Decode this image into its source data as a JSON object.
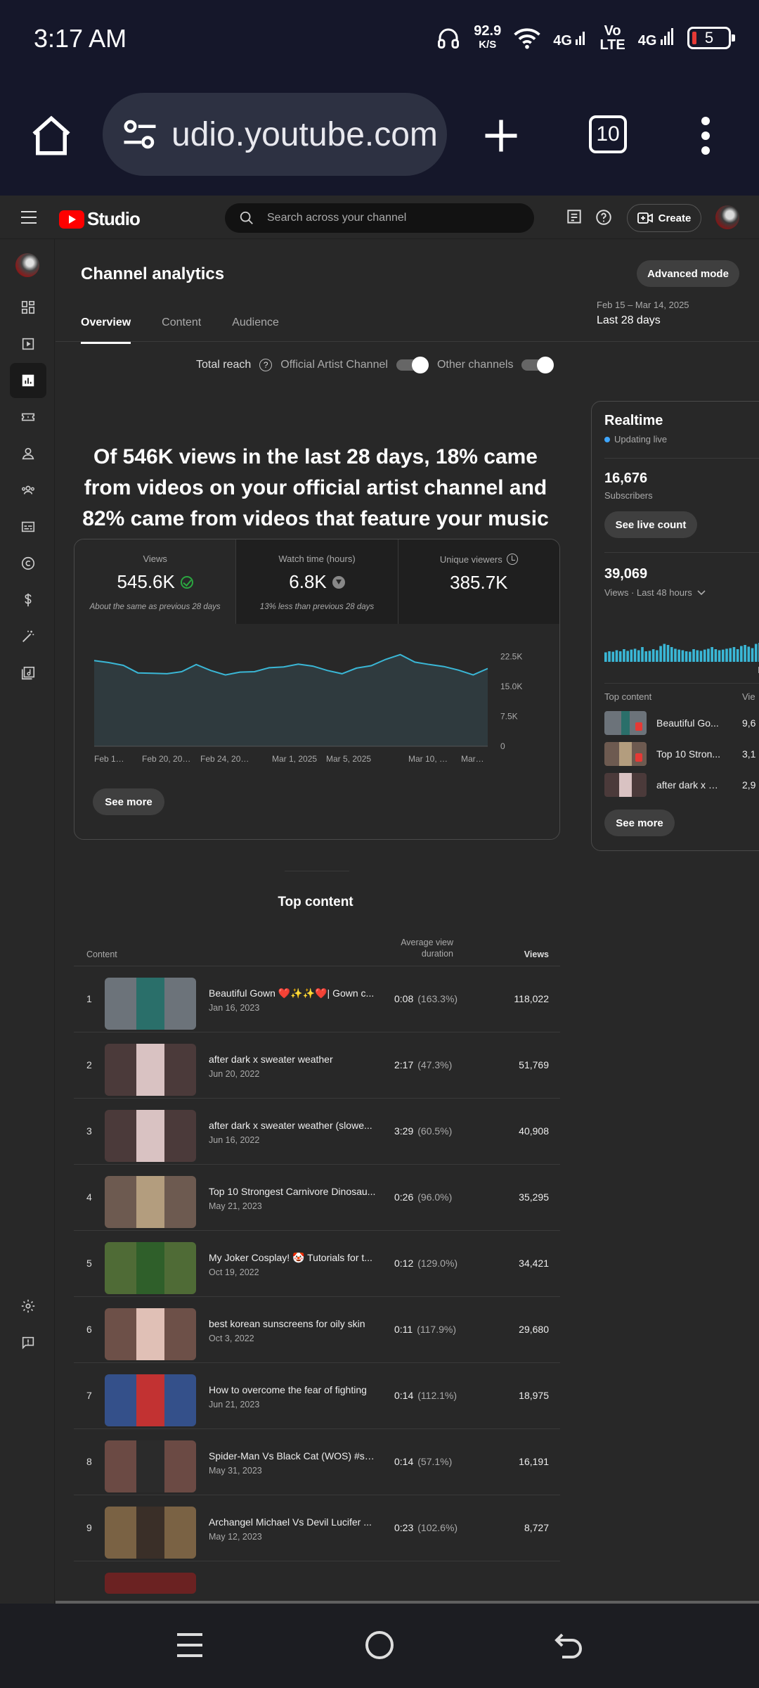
{
  "status_bar": {
    "time": "3:17 AM",
    "net_speed": "92.9",
    "net_speed_unit": "K/S",
    "signal1": "4G",
    "volte_1": "Vo",
    "volte_2": "LTE",
    "signal2": "4G",
    "battery": "5"
  },
  "browser": {
    "url": "udio.youtube.com",
    "tab_count": "10"
  },
  "studio": {
    "logo_text": "Studio",
    "search_placeholder": "Search across your channel",
    "create_label": "Create"
  },
  "page": {
    "title": "Channel analytics",
    "advanced_mode": "Advanced mode",
    "tabs": [
      "Overview",
      "Content",
      "Audience"
    ],
    "date_range": "Feb 15 – Mar 14, 2025",
    "period": "Last 28 days",
    "total_reach": "Total reach",
    "toggle_official": "Official Artist Channel",
    "toggle_other": "Other channels",
    "headline": "Of 546K views in the last 28 days, 18% came from videos on your official artist channel and 82% came from videos that feature your music on other channels"
  },
  "metrics": [
    {
      "label": "Views",
      "value": "545.6K",
      "note": "About the same as previous 28 days"
    },
    {
      "label": "Watch time (hours)",
      "value": "6.8K",
      "note": "13% less than previous 28 days"
    },
    {
      "label": "Unique viewers",
      "value": "385.7K",
      "note": ""
    }
  ],
  "chart_data": {
    "type": "area",
    "x_tick_labels": [
      "Feb 1…",
      "Feb 20, 20…",
      "Feb 24, 20…",
      "Mar 1, 2025",
      "Mar 5, 2025",
      "Mar 10, …",
      "Mar…"
    ],
    "y_tick_labels": [
      "22.5K",
      "15.0K",
      "7.5K",
      "0"
    ],
    "ylim": [
      0,
      30000
    ],
    "values": [
      21500,
      21000,
      20300,
      18400,
      18300,
      18200,
      18700,
      20500,
      19000,
      17900,
      18600,
      18700,
      19700,
      19900,
      20600,
      20100,
      19000,
      18200,
      19600,
      20200,
      21800,
      23000,
      21100,
      20500,
      20000,
      19100,
      17900,
      19500
    ],
    "color": "#3ab7d6",
    "grid": false
  },
  "see_more": "See more",
  "top_content": {
    "title": "Top content",
    "col_content": "Content",
    "col_avd": "Average view duration",
    "col_views": "Views",
    "rows": [
      {
        "rank": "1",
        "title": "Beautiful Gown ❤️✨✨❤️| Gown c...",
        "date": "Jan 16, 2023",
        "duration": "0:08",
        "pct": "(163.3%)",
        "views": "118,022"
      },
      {
        "rank": "2",
        "title": "after dark x sweater weather",
        "date": "Jun 20, 2022",
        "duration": "2:17",
        "pct": "(47.3%)",
        "views": "51,769"
      },
      {
        "rank": "3",
        "title": "after dark x sweater weather (slowe...",
        "date": "Jun 16, 2022",
        "duration": "3:29",
        "pct": "(60.5%)",
        "views": "40,908"
      },
      {
        "rank": "4",
        "title": "Top 10 Strongest Carnivore Dinosau...",
        "date": "May 21, 2023",
        "duration": "0:26",
        "pct": "(96.0%)",
        "views": "35,295"
      },
      {
        "rank": "5",
        "title": "My Joker Cosplay! 🤡 Tutorials for t...",
        "date": "Oct 19, 2022",
        "duration": "0:12",
        "pct": "(129.0%)",
        "views": "34,421"
      },
      {
        "rank": "6",
        "title": "best korean sunscreens for oily skin",
        "date": "Oct 3, 2022",
        "duration": "0:11",
        "pct": "(117.9%)",
        "views": "29,680"
      },
      {
        "rank": "7",
        "title": "How to overcome the fear of fighting",
        "date": "Jun 21, 2023",
        "duration": "0:14",
        "pct": "(112.1%)",
        "views": "18,975"
      },
      {
        "rank": "8",
        "title": "Spider-Man Vs Black Cat (WOS) #sh...",
        "date": "May 31, 2023",
        "duration": "0:14",
        "pct": "(57.1%)",
        "views": "16,191"
      },
      {
        "rank": "9",
        "title": "Archangel Michael Vs Devil Lucifer ...",
        "date": "May 12, 2023",
        "duration": "0:23",
        "pct": "(102.6%)",
        "views": "8,727"
      }
    ]
  },
  "realtime": {
    "title": "Realtime",
    "live": "Updating live",
    "subscribers": "16,676",
    "subscribers_label": "Subscribers",
    "see_live": "See live count",
    "views": "39,069",
    "views_label": "Views · Last 48 hours",
    "bar_axis_label": "N",
    "top_content_label": "Top content",
    "top_content_views_label": "Vie",
    "bars": [
      0.45,
      0.5,
      0.48,
      0.55,
      0.5,
      0.6,
      0.52,
      0.58,
      0.62,
      0.55,
      0.7,
      0.5,
      0.52,
      0.6,
      0.55,
      0.75,
      0.85,
      0.8,
      0.7,
      0.62,
      0.58,
      0.55,
      0.5,
      0.48,
      0.6,
      0.55,
      0.52,
      0.58,
      0.62,
      0.7,
      0.6,
      0.55,
      0.58,
      0.62,
      0.65,
      0.7,
      0.6,
      0.75,
      0.8,
      0.72,
      0.65,
      0.85,
      0.9,
      0.8,
      0.7,
      0.6
    ],
    "rows": [
      {
        "title": "Beautiful Go...",
        "views": "9,6"
      },
      {
        "title": "Top 10 Stron...",
        "views": "3,1"
      },
      {
        "title": "after dark x s...",
        "views": "2,9"
      }
    ],
    "see_more": "See more"
  }
}
